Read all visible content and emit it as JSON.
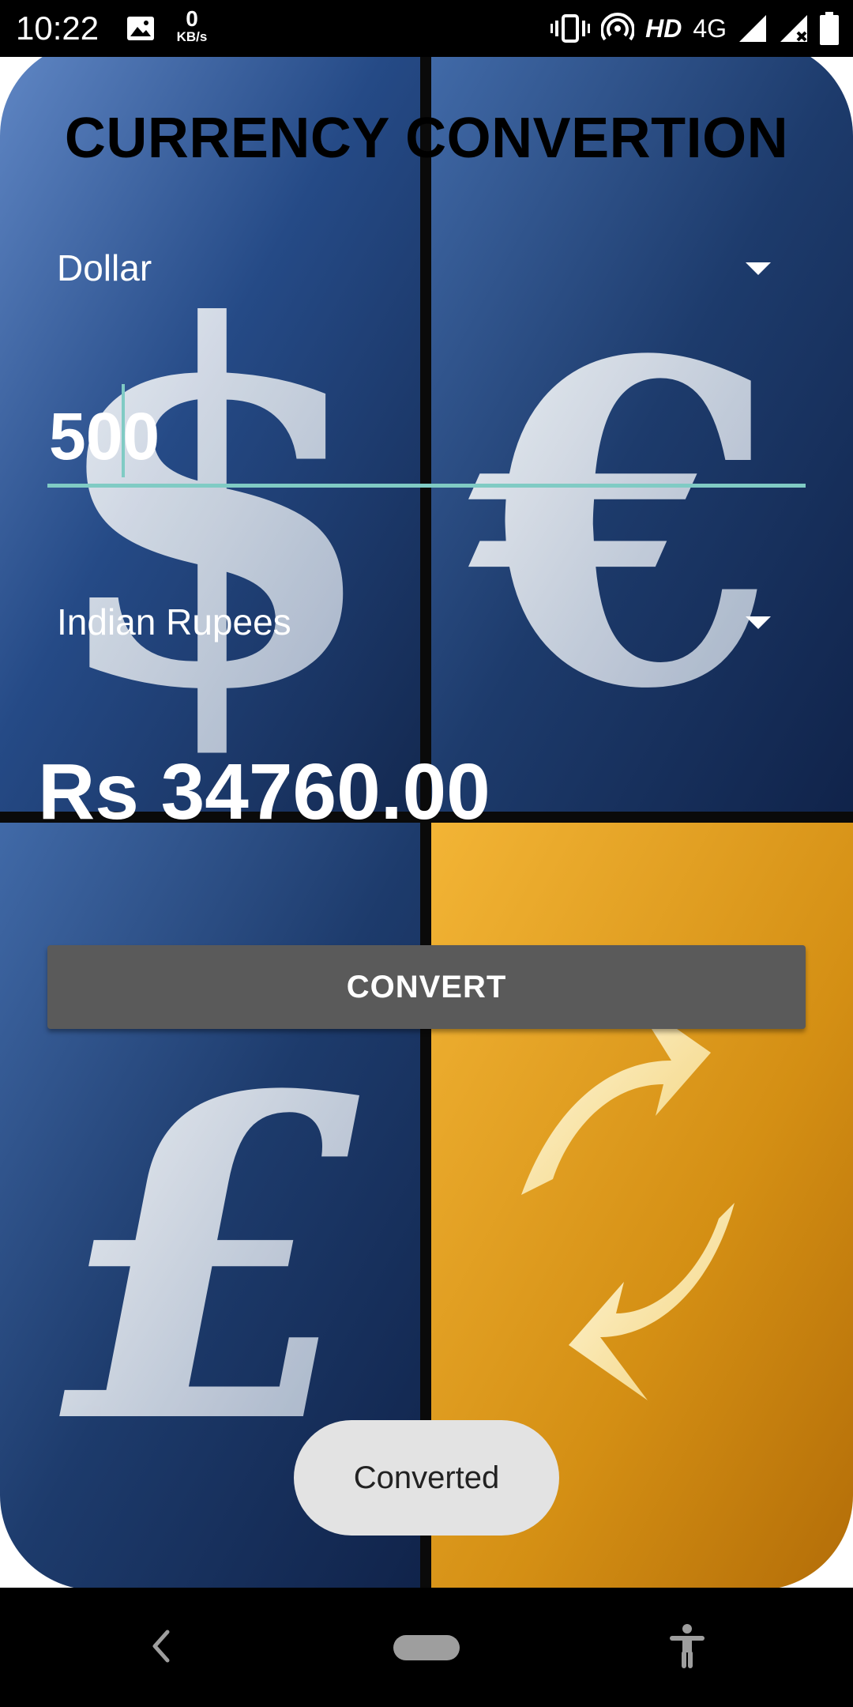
{
  "status_bar": {
    "time": "10:22",
    "data_rate_value": "0",
    "data_rate_unit": "KB/s",
    "hd_label": "HD",
    "network_label": "4G",
    "icons": [
      "image-icon",
      "vibrate-icon",
      "hotspot-icon",
      "signal-icon",
      "signal-no-data-icon",
      "battery-icon"
    ]
  },
  "app": {
    "title": "CURRENCY CONVERTION",
    "from_currency": "Dollar",
    "amount": "500",
    "to_currency": "Indian Rupees",
    "result": "Rs 34760.00",
    "convert_label": "CONVERT",
    "toast": "Converted",
    "colors": {
      "accent": "#80cbc4",
      "button": "#5a5a5a",
      "panel_blue": "#1f3d6e",
      "panel_gold": "#d99a1c"
    }
  },
  "nav_bar": {
    "icons": [
      "back-icon",
      "home-pill-icon",
      "accessibility-icon"
    ]
  }
}
